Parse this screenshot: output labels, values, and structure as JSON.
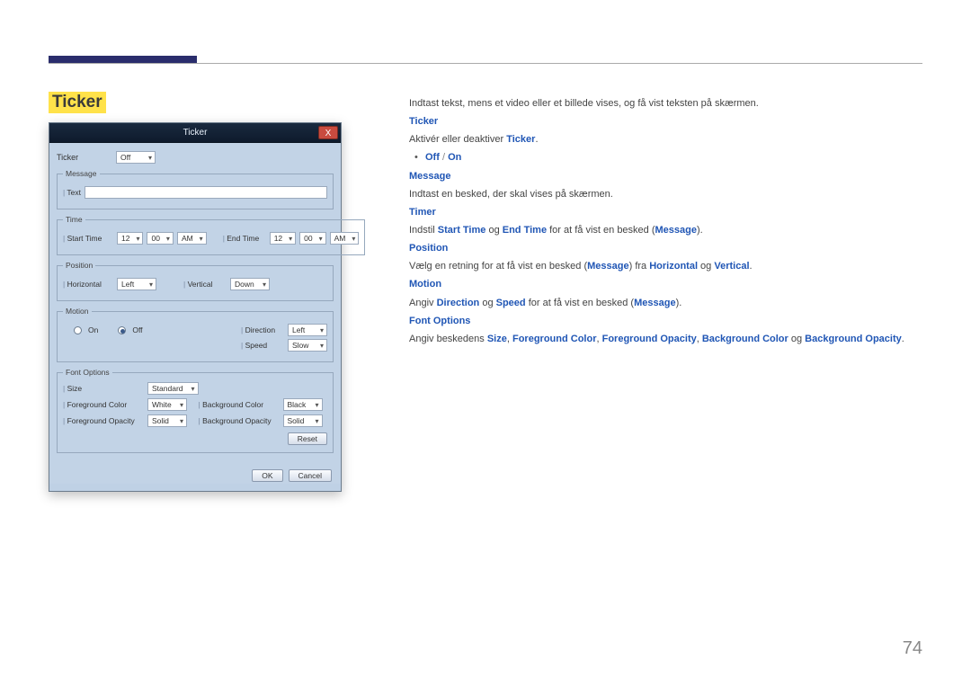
{
  "page": {
    "title": "Ticker",
    "number": "74"
  },
  "dialog": {
    "title": "Ticker",
    "close": "X",
    "ticker_label": "Ticker",
    "ticker_value": "Off",
    "message_legend": "Message",
    "text_label": "Text",
    "time_legend": "Time",
    "start_time_label": "Start Time",
    "end_time_label": "End Time",
    "t_h": "12",
    "t_m": "00",
    "t_ampm": "AM",
    "position_legend": "Position",
    "horizontal_label": "Horizontal",
    "horizontal_value": "Left",
    "vertical_label": "Vertical",
    "vertical_value": "Down",
    "motion_legend": "Motion",
    "motion_on": "On",
    "motion_off": "Off",
    "direction_label": "Direction",
    "direction_value": "Left",
    "speed_label": "Speed",
    "speed_value": "Slow",
    "font_legend": "Font Options",
    "size_label": "Size",
    "size_value": "Standard",
    "fg_color_label": "Foreground Color",
    "fg_color_value": "White",
    "fg_opacity_label": "Foreground Opacity",
    "fg_opacity_value": "Solid",
    "bg_color_label": "Background Color",
    "bg_color_value": "Black",
    "bg_opacity_label": "Background Opacity",
    "bg_opacity_value": "Solid",
    "reset": "Reset",
    "ok": "OK",
    "cancel": "Cancel"
  },
  "doc": {
    "intro": "Indtast tekst, mens et video eller et billede vises, og få vist teksten på skærmen.",
    "h_ticker": "Ticker",
    "p_ticker_1a": "Aktivér eller deaktiver ",
    "p_ticker_1b": "Ticker",
    "p_ticker_1c": ".",
    "off": "Off",
    "on": "On",
    "slash": " / ",
    "h_message": "Message",
    "p_message": "Indtast en besked, der skal vises på skærmen.",
    "h_timer": "Timer",
    "p_timer_a": "Indstil ",
    "p_timer_start": "Start Time",
    "p_timer_mid": " og ",
    "p_timer_end": "End Time",
    "p_timer_b": " for at få vist en besked (",
    "p_timer_msg": "Message",
    "p_timer_c": ").",
    "h_position": "Position",
    "p_pos_a": "Vælg en retning for at få vist en besked (",
    "p_pos_msg": "Message",
    "p_pos_b": ") fra ",
    "p_pos_h": "Horizontal",
    "p_pos_mid": " og ",
    "p_pos_v": "Vertical",
    "p_pos_c": ".",
    "h_motion": "Motion",
    "p_mot_a": "Angiv ",
    "p_mot_dir": "Direction",
    "p_mot_mid": " og ",
    "p_mot_spd": "Speed",
    "p_mot_b": " for at få vist en besked (",
    "p_mot_msg": "Message",
    "p_mot_c": ").",
    "h_font": "Font Options",
    "p_font_a": "Angiv beskedens ",
    "p_font_size": "Size",
    "p_font_s1": ", ",
    "p_font_fgc": "Foreground Color",
    "p_font_s2": ", ",
    "p_font_fgo": "Foreground Opacity",
    "p_font_s3": ", ",
    "p_font_bgc": "Background Color",
    "p_font_mid": " og ",
    "p_font_bgo": "Background Opacity",
    "p_font_c": "."
  }
}
